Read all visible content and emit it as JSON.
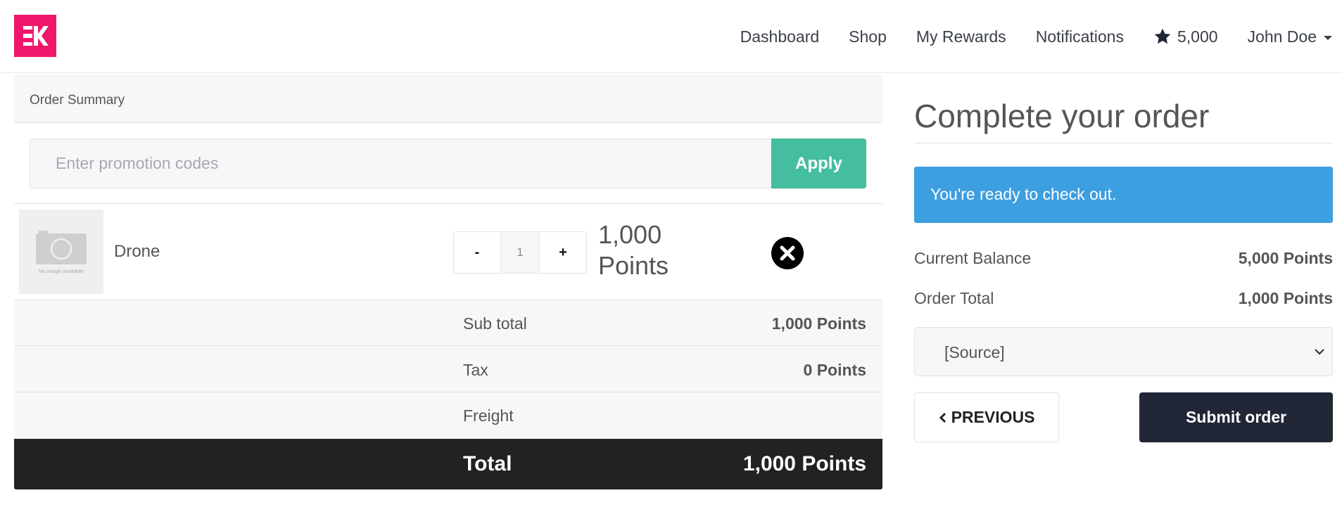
{
  "nav": {
    "items": [
      {
        "label": "Dashboard"
      },
      {
        "label": "Shop"
      },
      {
        "label": "My Rewards"
      },
      {
        "label": "Notifications"
      }
    ],
    "points_balance": "5,000",
    "user_name": "John Doe",
    "icons": {
      "points": "star-icon",
      "user_menu": "caret-down-icon"
    }
  },
  "brand": {
    "logo_color": "#f0166b"
  },
  "summary": {
    "title": "Order Summary",
    "promo_placeholder": "Enter promotion codes",
    "apply_label": "Apply",
    "item": {
      "name": "Drone",
      "image_text": "No image available",
      "qty_minus": "-",
      "quantity": "1",
      "qty_plus": "+",
      "price_amount": "1,000",
      "price_unit": "Points"
    },
    "rows": [
      {
        "label": "Sub total",
        "value": "1,000 Points"
      },
      {
        "label": "Tax",
        "value": "0 Points"
      },
      {
        "label": "Freight",
        "value": ""
      }
    ],
    "total": {
      "label": "Total",
      "value": "1,000 Points"
    }
  },
  "checkout": {
    "title": "Complete your order",
    "alert": "You're ready to check out.",
    "current_balance_label": "Current Balance",
    "current_balance_value": "5,000 Points",
    "order_total_label": "Order Total",
    "order_total_value": "1,000 Points",
    "source_selected": "[Source]",
    "previous_label": "PREVIOUS",
    "submit_label": "Submit order"
  },
  "colors": {
    "apply": "#45be9f",
    "alert": "#3d9ee0",
    "submit": "#212637",
    "total_band": "#222222"
  }
}
